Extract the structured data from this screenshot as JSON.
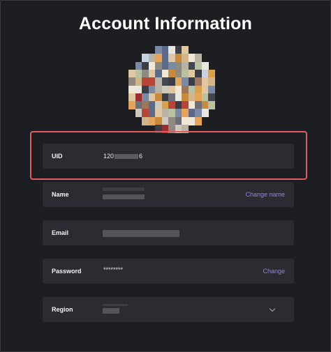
{
  "page": {
    "title": "Account Information"
  },
  "fields": {
    "uid": {
      "label": "UID",
      "value_prefix": "120",
      "value_suffix": "6"
    },
    "name": {
      "label": "Name",
      "action": "Change name"
    },
    "email": {
      "label": "Email"
    },
    "password": {
      "label": "Password",
      "value": "********",
      "action": "Change"
    },
    "region": {
      "label": "Region",
      "icon": "chevron-down-icon"
    }
  },
  "colors": {
    "background": "#1d1e22",
    "card": "#2b2c31",
    "accent_link": "#8b86e6",
    "highlight_border": "#e25e5e"
  }
}
